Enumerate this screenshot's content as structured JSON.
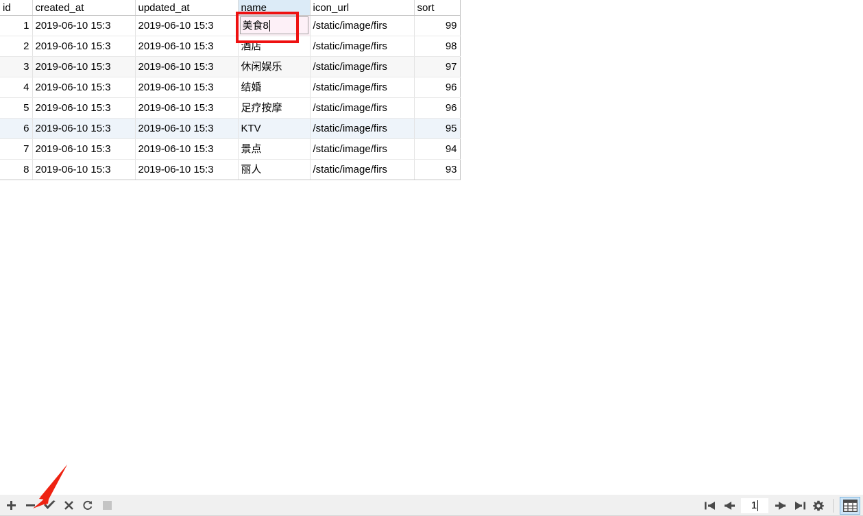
{
  "grid": {
    "columns": [
      {
        "key": "id",
        "label": "id",
        "align": "right"
      },
      {
        "key": "created_at",
        "label": "created_at",
        "align": "left"
      },
      {
        "key": "updated_at",
        "label": "updated_at",
        "align": "left"
      },
      {
        "key": "name",
        "label": "name",
        "align": "left",
        "selected": true
      },
      {
        "key": "icon_url",
        "label": "icon_url",
        "align": "left"
      },
      {
        "key": "sort",
        "label": "sort",
        "align": "right"
      }
    ],
    "rows": [
      {
        "id": "1",
        "created_at": "2019-06-10 15:3",
        "updated_at": "2019-06-10 15:3",
        "name": "美食8",
        "icon_url": "/static/image/firs",
        "sort": "99",
        "editing": true
      },
      {
        "id": "2",
        "created_at": "2019-06-10 15:3",
        "updated_at": "2019-06-10 15:3",
        "name": "酒店",
        "icon_url": "/static/image/firs",
        "sort": "98"
      },
      {
        "id": "3",
        "created_at": "2019-06-10 15:3",
        "updated_at": "2019-06-10 15:3",
        "name": "休闲娱乐",
        "icon_url": "/static/image/firs",
        "sort": "97"
      },
      {
        "id": "4",
        "created_at": "2019-06-10 15:3",
        "updated_at": "2019-06-10 15:3",
        "name": "结婚",
        "icon_url": "/static/image/firs",
        "sort": "96"
      },
      {
        "id": "5",
        "created_at": "2019-06-10 15:3",
        "updated_at": "2019-06-10 15:3",
        "name": "足疗按摩",
        "icon_url": "/static/image/firs",
        "sort": "96"
      },
      {
        "id": "6",
        "created_at": "2019-06-10 15:3",
        "updated_at": "2019-06-10 15:3",
        "name": "KTV",
        "icon_url": "/static/image/firs",
        "sort": "95",
        "highlighted": true
      },
      {
        "id": "7",
        "created_at": "2019-06-10 15:3",
        "updated_at": "2019-06-10 15:3",
        "name": "景点",
        "icon_url": "/static/image/firs",
        "sort": "94"
      },
      {
        "id": "8",
        "created_at": "2019-06-10 15:3",
        "updated_at": "2019-06-10 15:3",
        "name": "丽人",
        "icon_url": "/static/image/firs",
        "sort": "93"
      }
    ],
    "editing_cell": {
      "row_id": "1",
      "column": "name",
      "value": "美食8"
    }
  },
  "toolbar": {
    "left_buttons": [
      {
        "name": "add-row-button",
        "icon": "plus-icon",
        "label": "+",
        "enabled": true
      },
      {
        "name": "delete-row-button",
        "icon": "minus-icon",
        "label": "−",
        "enabled": true
      },
      {
        "name": "commit-changes-button",
        "icon": "check-icon",
        "label": "✓",
        "enabled": true
      },
      {
        "name": "revert-changes-button",
        "icon": "cross-icon",
        "label": "✕",
        "enabled": true
      },
      {
        "name": "refresh-button",
        "icon": "refresh-icon",
        "label": "⟳",
        "enabled": true
      },
      {
        "name": "stop-button",
        "icon": "stop-square-icon",
        "label": "■",
        "enabled": false
      }
    ],
    "right_buttons": [
      {
        "name": "first-page-button",
        "icon": "first-page-icon"
      },
      {
        "name": "previous-page-button",
        "icon": "arrow-left-icon"
      },
      {
        "name": "next-page-button",
        "icon": "arrow-right-icon"
      },
      {
        "name": "last-page-button",
        "icon": "last-page-icon"
      },
      {
        "name": "settings-button",
        "icon": "gear-icon"
      },
      {
        "name": "grid-view-button",
        "icon": "table-grid-icon"
      }
    ],
    "page_number": "1"
  },
  "annotations": {
    "highlight_rect": {
      "target": "name-cell-row-1",
      "color": "#ee1111"
    },
    "arrow": {
      "target": "commit-changes-button",
      "color": "#ee2211"
    }
  },
  "colors": {
    "selected_column_header": "#dcebf7",
    "highlighted_row": "#eef4fa",
    "stripe_row": "#f7f7f7",
    "annotation_red": "#ee1111",
    "toolbar_bg": "#f0f0f0",
    "grid_view_selected": "#cde5f7"
  }
}
